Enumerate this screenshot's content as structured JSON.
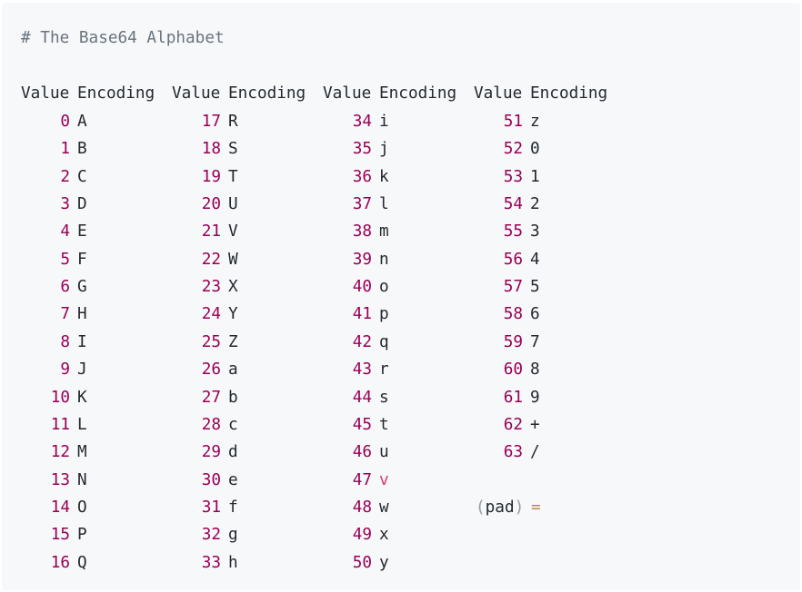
{
  "comment": "# The Base64 Alphabet",
  "header": {
    "value_label": "Value",
    "encoding_label": "Encoding"
  },
  "columns": [
    {
      "rows": [
        {
          "v": "0",
          "e": "A"
        },
        {
          "v": "1",
          "e": "B"
        },
        {
          "v": "2",
          "e": "C"
        },
        {
          "v": "3",
          "e": "D"
        },
        {
          "v": "4",
          "e": "E"
        },
        {
          "v": "5",
          "e": "F"
        },
        {
          "v": "6",
          "e": "G"
        },
        {
          "v": "7",
          "e": "H"
        },
        {
          "v": "8",
          "e": "I"
        },
        {
          "v": "9",
          "e": "J"
        },
        {
          "v": "10",
          "e": "K"
        },
        {
          "v": "11",
          "e": "L"
        },
        {
          "v": "12",
          "e": "M"
        },
        {
          "v": "13",
          "e": "N"
        },
        {
          "v": "14",
          "e": "O"
        },
        {
          "v": "15",
          "e": "P"
        },
        {
          "v": "16",
          "e": "Q"
        }
      ]
    },
    {
      "rows": [
        {
          "v": "17",
          "e": "R"
        },
        {
          "v": "18",
          "e": "S"
        },
        {
          "v": "19",
          "e": "T"
        },
        {
          "v": "20",
          "e": "U"
        },
        {
          "v": "21",
          "e": "V"
        },
        {
          "v": "22",
          "e": "W"
        },
        {
          "v": "23",
          "e": "X"
        },
        {
          "v": "24",
          "e": "Y"
        },
        {
          "v": "25",
          "e": "Z"
        },
        {
          "v": "26",
          "e": "a"
        },
        {
          "v": "27",
          "e": "b"
        },
        {
          "v": "28",
          "e": "c"
        },
        {
          "v": "29",
          "e": "d"
        },
        {
          "v": "30",
          "e": "e"
        },
        {
          "v": "31",
          "e": "f"
        },
        {
          "v": "32",
          "e": "g"
        },
        {
          "v": "33",
          "e": "h"
        }
      ]
    },
    {
      "rows": [
        {
          "v": "34",
          "e": "i"
        },
        {
          "v": "35",
          "e": "j"
        },
        {
          "v": "36",
          "e": "k"
        },
        {
          "v": "37",
          "e": "l"
        },
        {
          "v": "38",
          "e": "m"
        },
        {
          "v": "39",
          "e": "n"
        },
        {
          "v": "40",
          "e": "o"
        },
        {
          "v": "41",
          "e": "p"
        },
        {
          "v": "42",
          "e": "q"
        },
        {
          "v": "43",
          "e": "r"
        },
        {
          "v": "44",
          "e": "s"
        },
        {
          "v": "45",
          "e": "t"
        },
        {
          "v": "46",
          "e": "u"
        },
        {
          "v": "47",
          "e": "v"
        },
        {
          "v": "48",
          "e": "w"
        },
        {
          "v": "49",
          "e": "x"
        },
        {
          "v": "50",
          "e": "y"
        }
      ]
    },
    {
      "rows": [
        {
          "v": "51",
          "e": "z"
        },
        {
          "v": "52",
          "e": "0"
        },
        {
          "v": "53",
          "e": "1"
        },
        {
          "v": "54",
          "e": "2"
        },
        {
          "v": "55",
          "e": "3"
        },
        {
          "v": "56",
          "e": "4"
        },
        {
          "v": "57",
          "e": "5"
        },
        {
          "v": "58",
          "e": "6"
        },
        {
          "v": "59",
          "e": "7"
        },
        {
          "v": "60",
          "e": "8"
        },
        {
          "v": "61",
          "e": "9"
        },
        {
          "v": "62",
          "e": "+"
        },
        {
          "v": "63",
          "e": "/"
        }
      ]
    }
  ],
  "pad": {
    "open": "(",
    "label": "pad",
    "close": ")",
    "encoding": "="
  },
  "colors": {
    "background": "#f6f8fa",
    "text": "#24292e",
    "comment": "#6a737d",
    "number": "#990055",
    "highlight": "#d73a7a",
    "operator": "#b58a5a"
  }
}
